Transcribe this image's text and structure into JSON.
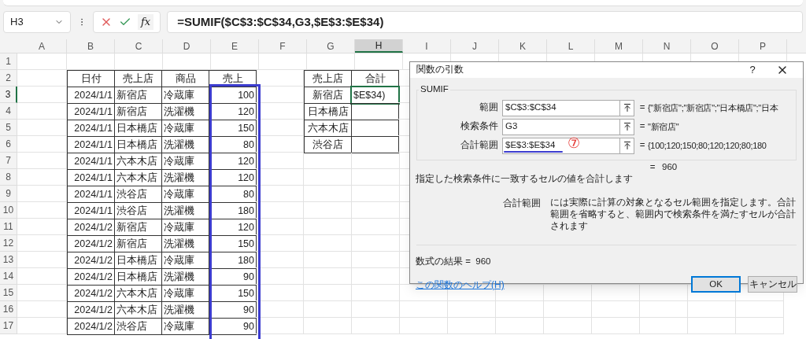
{
  "name_box": {
    "value": "H3"
  },
  "formula_bar": {
    "function_label": "fx",
    "formula": "=SUMIF($C$3:$C$34,G3,$E$3:$E$34)"
  },
  "columns": [
    {
      "label": "A",
      "selected": false
    },
    {
      "label": "B",
      "selected": false
    },
    {
      "label": "C",
      "selected": false
    },
    {
      "label": "D",
      "selected": false
    },
    {
      "label": "E",
      "selected": false
    },
    {
      "label": "F",
      "selected": false
    },
    {
      "label": "G",
      "selected": false
    },
    {
      "label": "H",
      "selected": true
    },
    {
      "label": "I",
      "selected": false
    },
    {
      "label": "J",
      "selected": false
    },
    {
      "label": "K",
      "selected": false
    },
    {
      "label": "L",
      "selected": false
    },
    {
      "label": "M",
      "selected": false
    },
    {
      "label": "N",
      "selected": false
    },
    {
      "label": "O",
      "selected": false
    },
    {
      "label": "P",
      "selected": false
    }
  ],
  "rows": [
    {
      "label": "1",
      "selected": false
    },
    {
      "label": "2",
      "selected": false
    },
    {
      "label": "3",
      "selected": true
    },
    {
      "label": "4",
      "selected": false
    },
    {
      "label": "5",
      "selected": false
    },
    {
      "label": "6",
      "selected": false
    },
    {
      "label": "7",
      "selected": false
    },
    {
      "label": "8",
      "selected": false
    },
    {
      "label": "9",
      "selected": false
    },
    {
      "label": "10",
      "selected": false
    },
    {
      "label": "11",
      "selected": false
    },
    {
      "label": "12",
      "selected": false
    },
    {
      "label": "13",
      "selected": false
    },
    {
      "label": "14",
      "selected": false
    },
    {
      "label": "15",
      "selected": false
    },
    {
      "label": "16",
      "selected": false
    },
    {
      "label": "17",
      "selected": false
    }
  ],
  "sales_table": {
    "headers": [
      "日付",
      "売上店",
      "商品",
      "売上"
    ],
    "rows": [
      [
        "2024/1/1",
        "新宿店",
        "冷蔵庫",
        "100"
      ],
      [
        "2024/1/1",
        "新宿店",
        "洗濯機",
        "120"
      ],
      [
        "2024/1/1",
        "日本橋店",
        "冷蔵庫",
        "150"
      ],
      [
        "2024/1/1",
        "日本橋店",
        "洗濯機",
        "80"
      ],
      [
        "2024/1/1",
        "六本木店",
        "冷蔵庫",
        "120"
      ],
      [
        "2024/1/1",
        "六本木店",
        "洗濯機",
        "120"
      ],
      [
        "2024/1/1",
        "渋谷店",
        "冷蔵庫",
        "80"
      ],
      [
        "2024/1/1",
        "渋谷店",
        "洗濯機",
        "180"
      ],
      [
        "2024/1/2",
        "新宿店",
        "冷蔵庫",
        "120"
      ],
      [
        "2024/1/2",
        "新宿店",
        "洗濯機",
        "150"
      ],
      [
        "2024/1/2",
        "日本橋店",
        "冷蔵庫",
        "180"
      ],
      [
        "2024/1/2",
        "日本橋店",
        "洗濯機",
        "90"
      ],
      [
        "2024/1/2",
        "六本木店",
        "冷蔵庫",
        "150"
      ],
      [
        "2024/1/2",
        "六本木店",
        "洗濯機",
        "90"
      ],
      [
        "2024/1/2",
        "渋谷店",
        "冷蔵庫",
        "90"
      ]
    ]
  },
  "summary_table": {
    "headers": [
      "売上店",
      "合計"
    ],
    "rows": [
      {
        "store": "新宿店",
        "total": "$E$34)",
        "active": true
      },
      {
        "store": "日本橋店",
        "active": false
      },
      {
        "store": "六本木店",
        "active": false
      },
      {
        "store": "渋谷店",
        "active": false
      }
    ]
  },
  "dialog": {
    "title": "関数の引数",
    "help": "?",
    "function_name": "SUMIF",
    "arguments": [
      {
        "label": "範囲",
        "value": "$C$3:$C$34",
        "eq": "=",
        "result": "{\"新宿店\";\"新宿店\";\"日本橋店\";\"日本",
        "underlined": false
      },
      {
        "label": "検索条件",
        "value": "G3",
        "eq": "=",
        "result": "\"新宿店\"",
        "underlined": false
      },
      {
        "label": "合計範囲",
        "value": "$E$3:$E$34",
        "eq": "=",
        "result": "{100;120;150;80;120;120;80;180",
        "underlined": true,
        "annotation": "⑦"
      }
    ],
    "total_eq": "=",
    "total": "960",
    "description": "指定した検索条件に一致するセルの値を合計します",
    "argument_help": {
      "label": "合計範囲",
      "text": "には実際に計算の対象となるセル範囲を指定します。合計範囲を省略すると、範囲内で検索条件を満たすセルが合計されます"
    },
    "formula_result": {
      "label": "数式の結果 =",
      "value": "960"
    },
    "help_link": "この関数のヘルプ(H)",
    "buttons": [
      {
        "label": "OK",
        "default": true
      },
      {
        "label": "キャンセル",
        "default": false
      }
    ]
  }
}
